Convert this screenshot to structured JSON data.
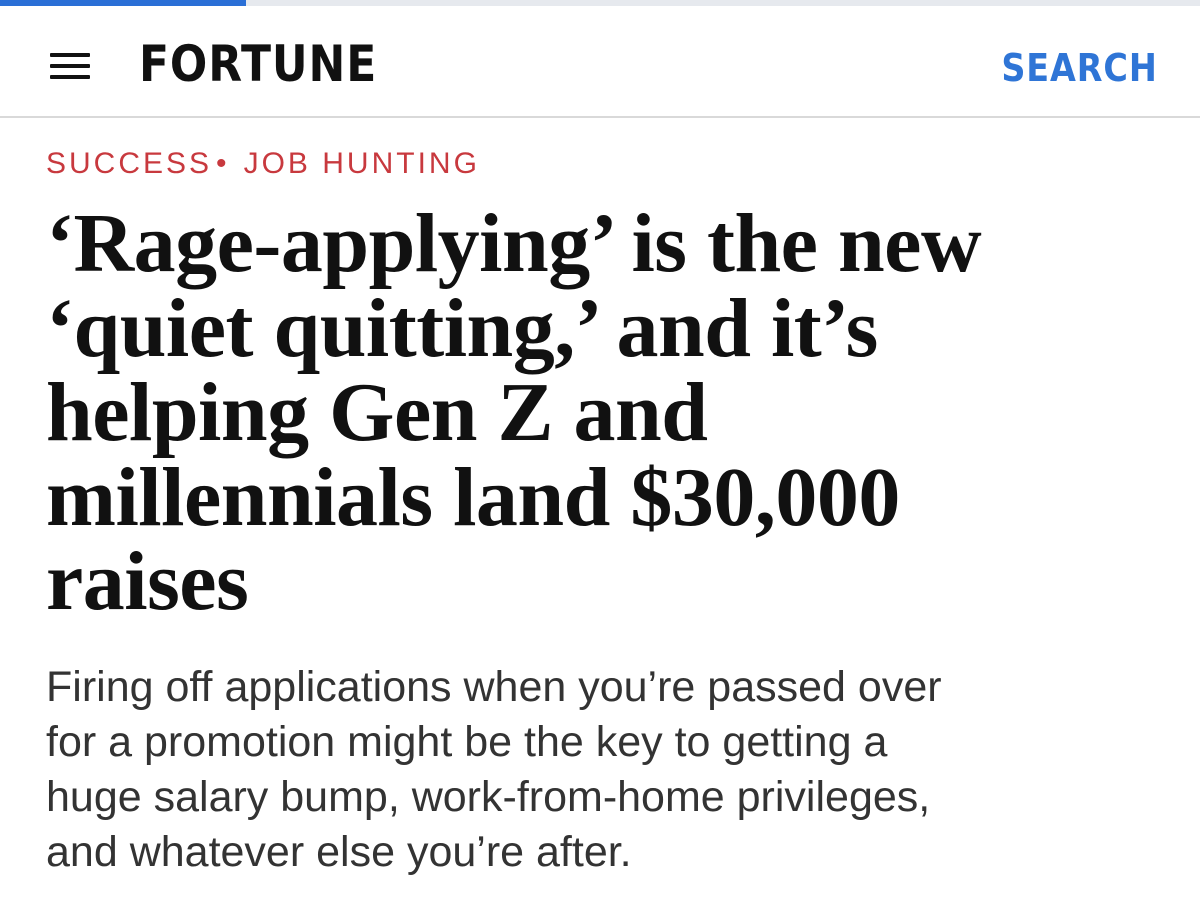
{
  "progress": {
    "value": 0.205,
    "color": "#2a6fd6"
  },
  "header": {
    "menu_icon": "hamburger-menu-icon",
    "logo_text": "FORTUNE",
    "search_label": "SEARCH",
    "search_color": "#2f75d6"
  },
  "article": {
    "kicker": {
      "section": "SUCCESS",
      "separator": "•",
      "topic": "JOB HUNTING",
      "color": "#c8393e"
    },
    "headline_lines": [
      "‘Rage-applying’ is the new",
      "‘quiet quitting,’ and it’s",
      "helping Gen Z and",
      "millennials land $30,000",
      "raises"
    ],
    "dek_lines": [
      "Firing off applications when you’re passed over",
      "for a promotion might be the key to getting a",
      "huge salary bump, work-from-home privileges,",
      "and whatever else you’re after."
    ]
  }
}
